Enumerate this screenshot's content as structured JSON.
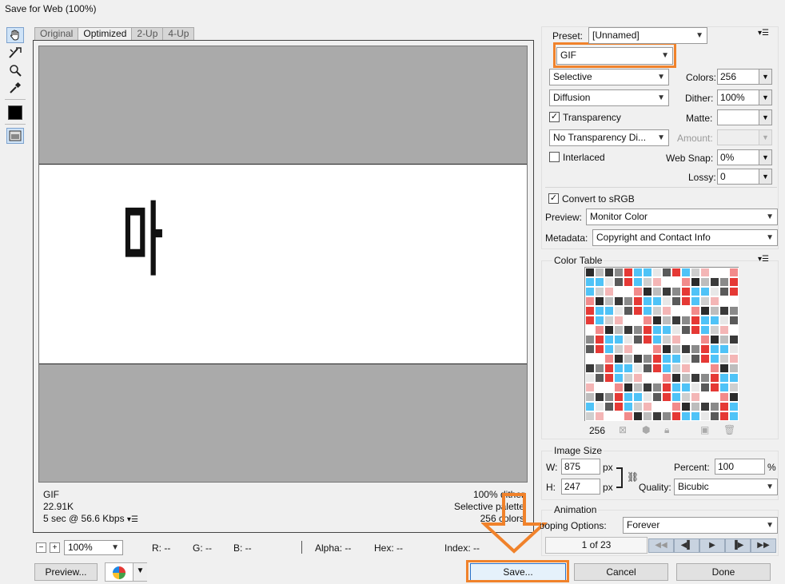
{
  "window": {
    "title": "Save for Web (100%)"
  },
  "tabs": [
    {
      "label": "Original",
      "active": false
    },
    {
      "label": "Optimized",
      "active": true
    },
    {
      "label": "2-Up",
      "active": false
    },
    {
      "label": "4-Up",
      "active": false
    }
  ],
  "tools": [
    "hand-icon",
    "slice-select-icon",
    "zoom-icon",
    "eyedropper-icon",
    "color-swatch-icon",
    "toggle-slices-icon"
  ],
  "preview": {
    "glyph": "마",
    "info_left": [
      "GIF",
      "22.91K",
      "5 sec @ 56.6 Kbps"
    ],
    "info_right": [
      "100% dither",
      "Selective palette",
      "256 colors"
    ]
  },
  "statusbar": {
    "zoom": "100%",
    "r": "R: --",
    "g": "G: --",
    "b": "B: --",
    "alpha": "Alpha: --",
    "hex": "Hex: --",
    "index": "Index: --"
  },
  "buttons": {
    "preview": "Preview...",
    "save": "Save...",
    "cancel": "Cancel",
    "done": "Done"
  },
  "settings": {
    "preset_label": "Preset:",
    "preset_value": "[Unnamed]",
    "format": "GIF",
    "reduction": "Selective",
    "colors_label": "Colors:",
    "colors_value": "256",
    "dither_algo": "Diffusion",
    "dither_label": "Dither:",
    "dither_value": "100%",
    "transparency_label": "Transparency",
    "transparency_checked": true,
    "matte_label": "Matte:",
    "trans_dither": "No Transparency Di...",
    "amount_label": "Amount:",
    "interlaced_label": "Interlaced",
    "interlaced_checked": false,
    "websnap_label": "Web Snap:",
    "websnap_value": "0%",
    "lossy_label": "Lossy:",
    "lossy_value": "0",
    "srgb_label": "Convert to sRGB",
    "srgb_checked": true,
    "preview_label": "Preview:",
    "preview_value": "Monitor Color",
    "metadata_label": "Metadata:",
    "metadata_value": "Copyright and Contact Info"
  },
  "color_table": {
    "title": "Color Table",
    "count": "256",
    "colors": [
      "#2b2b2b",
      "#e8e8e8",
      "#ffffff",
      "#4fc3f7",
      "#f4b6b6",
      "#8a8a8a",
      "#4fc3f7",
      "#bdbdbd",
      "#5a5a5a",
      "#f28b8b",
      "#4fc3f7",
      "#ffffff",
      "#e53935",
      "#cfcfcf",
      "#3a3a3a",
      "#e53935"
    ],
    "colors_note_hidden": ""
  },
  "image_size": {
    "title": "Image Size",
    "w_label": "W:",
    "w_value": "875",
    "w_unit": "px",
    "h_label": "H:",
    "h_value": "247",
    "h_unit": "px",
    "percent_label": "Percent:",
    "percent_value": "100",
    "percent_unit": "%",
    "quality_label": "Quality:",
    "quality_value": "Bicubic"
  },
  "animation": {
    "title": "Animation",
    "looping_label": "Looping Options:",
    "looping_value": "Forever",
    "frame": "1 of 23"
  }
}
